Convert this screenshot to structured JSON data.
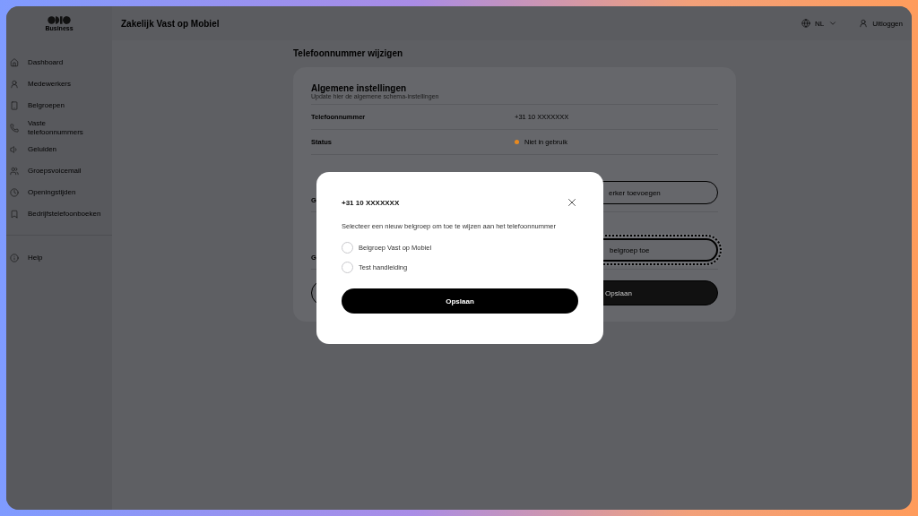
{
  "header": {
    "logo_text": "Business",
    "title": "Zakelijk Vast op Mobiel",
    "language": "NL",
    "logout": "Uitloggen"
  },
  "sidebar": {
    "items": [
      {
        "label": "Dashboard"
      },
      {
        "label": "Medewerkers"
      },
      {
        "label": "Belgroepen"
      },
      {
        "label": "Vaste telefoonnummers"
      },
      {
        "label": "Geluiden"
      },
      {
        "label": "Groepsvoicemail"
      },
      {
        "label": "Openingstijden"
      },
      {
        "label": "Bedrijfstelefoonboeken"
      }
    ],
    "footer_items": [
      {
        "label": "Help"
      }
    ]
  },
  "page": {
    "title": "Telefoonnummer wijzigen",
    "card": {
      "title": "Algemene instellingen",
      "subtitle": "Update hier de algemene schema-instellingen",
      "rows": [
        {
          "kind": "text",
          "label": "Telefoonnummer",
          "value": "+31 10 XXXXXXX"
        },
        {
          "kind": "status",
          "label": "Status",
          "value": "Niet in gebruik",
          "color": "#e8891f"
        },
        {
          "kind": "button",
          "label": "G",
          "button": "erker toevoegen",
          "focused": false
        },
        {
          "kind": "button",
          "label": "G",
          "button": "belgroep toe",
          "focused": true
        }
      ],
      "actions": [
        {
          "kind": "outline"
        },
        {
          "kind": "filled",
          "label": "Opslaan"
        }
      ]
    }
  },
  "modal": {
    "title": "+31 10 XXXXXXX",
    "prompt": "Selecteer een nieuw belgroep om toe te wijzen aan het telefoonnummer",
    "options": [
      {
        "label": "Belgroep Vast op Mobiel",
        "selected": false
      },
      {
        "label": "Test handleiding",
        "selected": false
      }
    ],
    "button": "Opslaan"
  }
}
